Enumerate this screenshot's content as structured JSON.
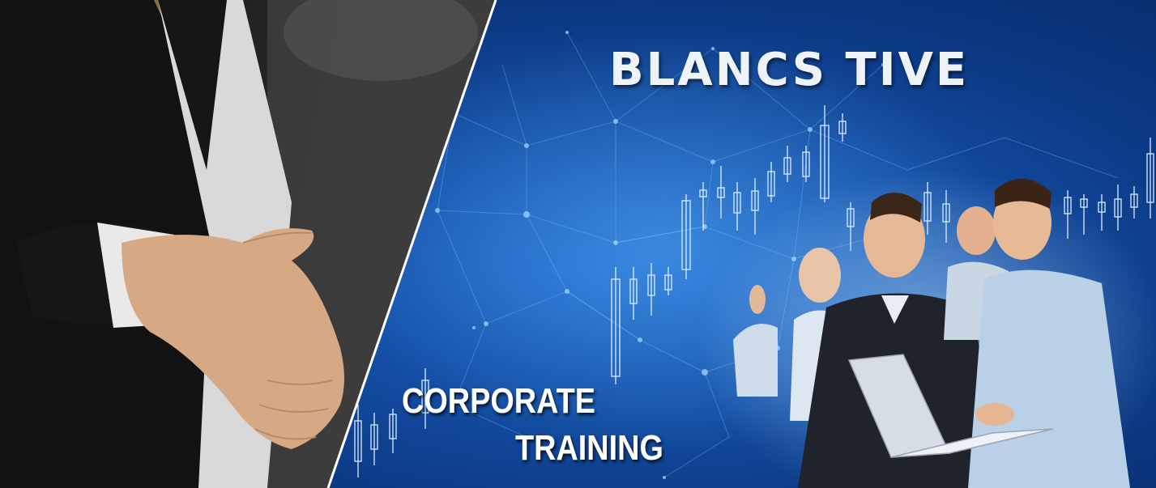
{
  "banner": {
    "brand": "BLANCS TIVE",
    "tagline_line1": "CORPORATE",
    "tagline_line2": "TRAINING"
  },
  "colors": {
    "panel_blue": "#134fa6",
    "panel_dark": "#2b2b2b",
    "text": "#ffffff"
  },
  "imagery": {
    "left_photo": "handshake-offer",
    "right_photo": "business-team-celebrating",
    "background_motif": "candlestick-network"
  }
}
